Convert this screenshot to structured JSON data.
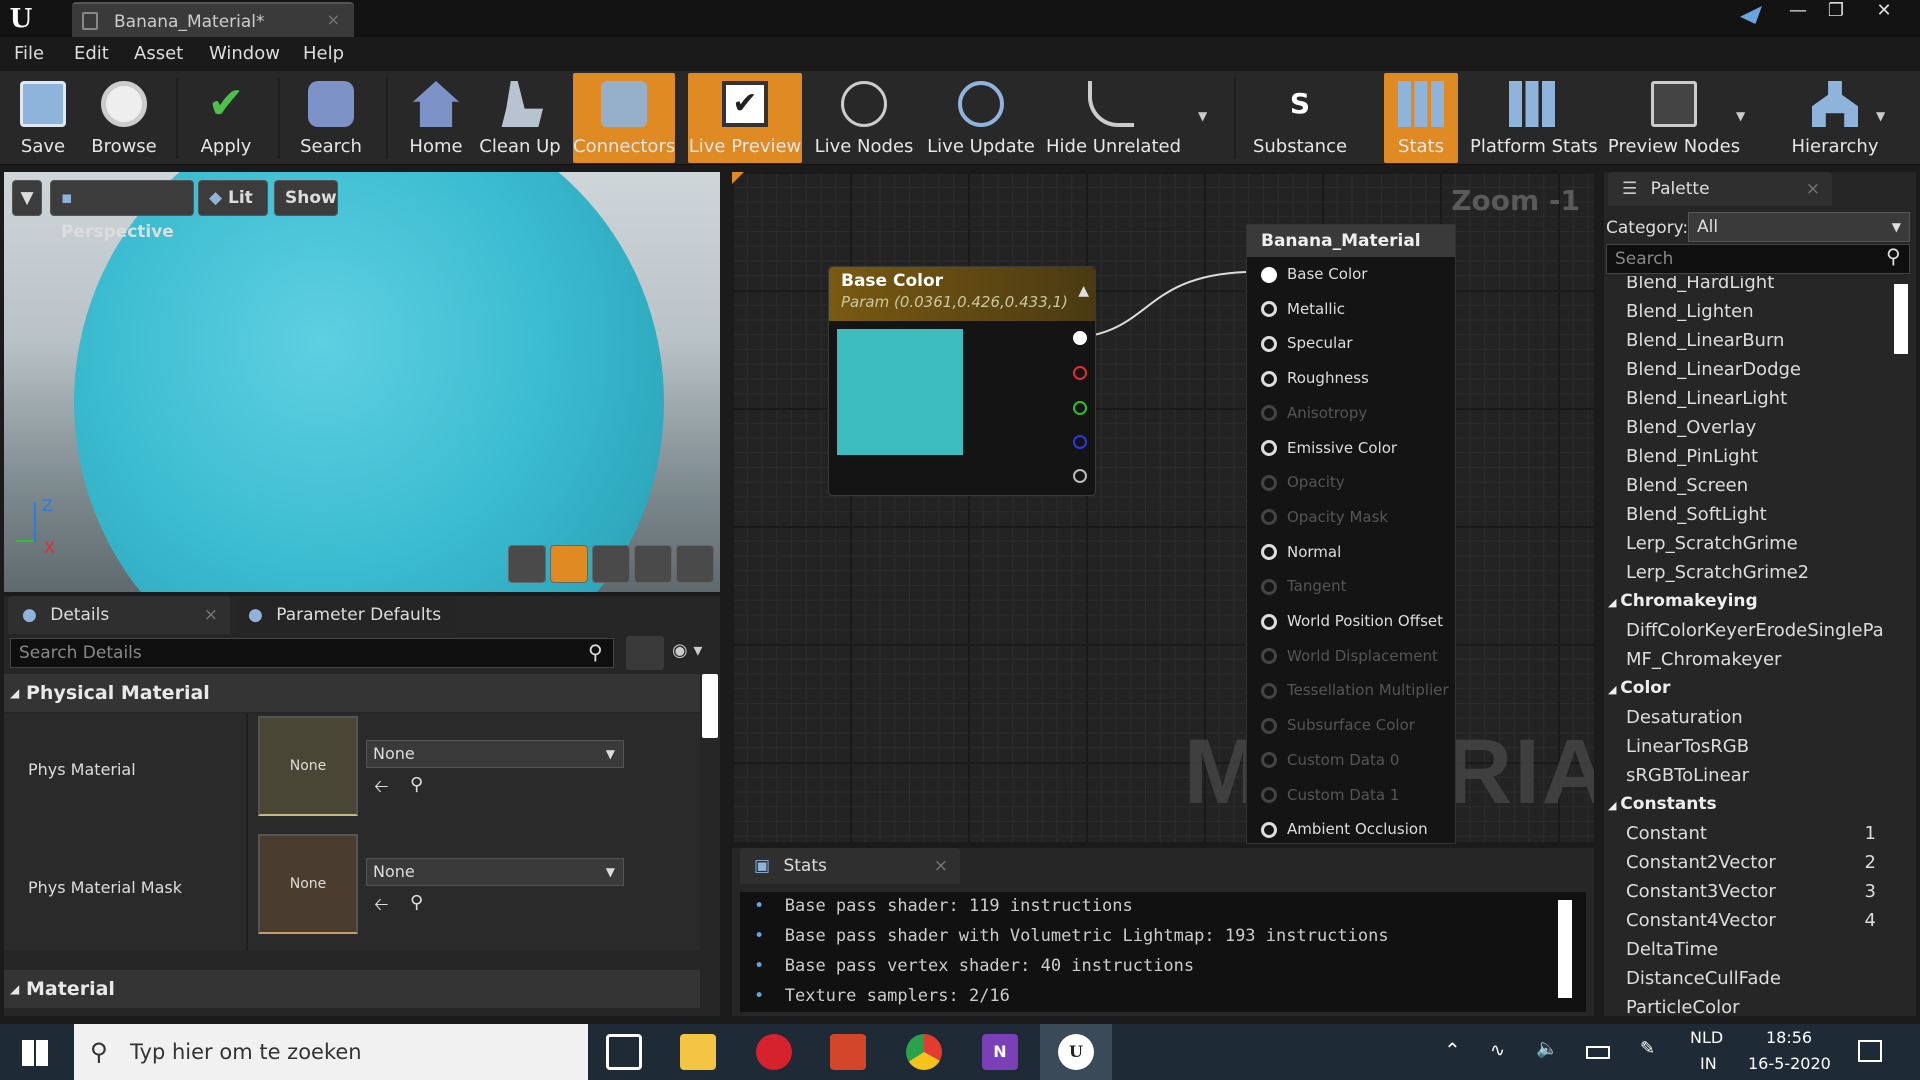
{
  "window": {
    "tab_title": "Banana_Material*",
    "close_symbol": "×"
  },
  "menu": [
    "File",
    "Edit",
    "Asset",
    "Window",
    "Help"
  ],
  "toolbar": {
    "buttons": [
      "Save",
      "Browse",
      "Apply",
      "Search",
      "Home",
      "Clean Up",
      "Connectors",
      "Live Preview",
      "Live Nodes",
      "Live Update",
      "Hide Unrelated",
      "Substance",
      "Stats",
      "Platform Stats",
      "Preview Nodes",
      "Hierarchy"
    ],
    "active": [
      "Connectors",
      "Live Preview",
      "Stats"
    ],
    "accent_color": "#e08a23"
  },
  "viewport": {
    "perspective": "Perspective",
    "lit": "Lit",
    "show": "Show",
    "axis_z": "Z",
    "axis_x": "X"
  },
  "details": {
    "tab_details": "Details",
    "tab_params": "Parameter Defaults",
    "search_placeholder": "Search Details",
    "cat_physical": "Physical Material",
    "phys_material_label": "Phys Material",
    "phys_material_thumb": "None",
    "phys_material_value": "None",
    "phys_mask_label": "Phys Material Mask",
    "phys_mask_thumb": "None",
    "phys_mask_value": "None",
    "cat_material": "Material"
  },
  "graph": {
    "zoom": "Zoom -1",
    "watermark": "MATERIAL",
    "param_node": {
      "title": "Base Color",
      "subtitle": "Param (0.0361,0.426,0.433,1)",
      "swatch_color": "#3cbcbc"
    },
    "material_node": {
      "title": "Banana_Material",
      "pins": [
        {
          "label": "Base Color",
          "enabled": true
        },
        {
          "label": "Metallic",
          "enabled": true
        },
        {
          "label": "Specular",
          "enabled": true
        },
        {
          "label": "Roughness",
          "enabled": true
        },
        {
          "label": "Anisotropy",
          "enabled": false
        },
        {
          "label": "Emissive Color",
          "enabled": true
        },
        {
          "label": "Opacity",
          "enabled": false
        },
        {
          "label": "Opacity Mask",
          "enabled": false
        },
        {
          "label": "Normal",
          "enabled": true
        },
        {
          "label": "Tangent",
          "enabled": false
        },
        {
          "label": "World Position Offset",
          "enabled": true
        },
        {
          "label": "World Displacement",
          "enabled": false
        },
        {
          "label": "Tessellation Multiplier",
          "enabled": false
        },
        {
          "label": "Subsurface Color",
          "enabled": false
        },
        {
          "label": "Custom Data 0",
          "enabled": false
        },
        {
          "label": "Custom Data 1",
          "enabled": false
        },
        {
          "label": "Ambient Occlusion",
          "enabled": true
        }
      ]
    }
  },
  "stats": {
    "tab": "Stats",
    "lines": [
      "Base pass shader: 119 instructions",
      "Base pass shader with Volumetric Lightmap: 193 instructions",
      "Base pass vertex shader: 40 instructions",
      "Texture samplers: 2/16"
    ]
  },
  "palette": {
    "tab": "Palette",
    "category_label": "Category:",
    "category_value": "All",
    "search_placeholder": "Search",
    "items": [
      {
        "label": "Blend_HardLight"
      },
      {
        "label": "Blend_Lighten"
      },
      {
        "label": "Blend_LinearBurn"
      },
      {
        "label": "Blend_LinearDodge"
      },
      {
        "label": "Blend_LinearLight"
      },
      {
        "label": "Blend_Overlay"
      },
      {
        "label": "Blend_PinLight"
      },
      {
        "label": "Blend_Screen"
      },
      {
        "label": "Blend_SoftLight"
      },
      {
        "label": "Lerp_ScratchGrime"
      },
      {
        "label": "Lerp_ScratchGrime2"
      },
      {
        "label": "Chromakeying",
        "header": true
      },
      {
        "label": "DiffColorKeyerErodeSinglePa"
      },
      {
        "label": "MF_Chromakeyer"
      },
      {
        "label": "Color",
        "header": true
      },
      {
        "label": "Desaturation"
      },
      {
        "label": "LinearTosRGB"
      },
      {
        "label": "sRGBToLinear"
      },
      {
        "label": "Constants",
        "header": true
      },
      {
        "label": "Constant",
        "key": "1"
      },
      {
        "label": "Constant2Vector",
        "key": "2"
      },
      {
        "label": "Constant3Vector",
        "key": "3"
      },
      {
        "label": "Constant4Vector",
        "key": "4"
      },
      {
        "label": "DeltaTime"
      },
      {
        "label": "DistanceCullFade"
      },
      {
        "label": "ParticleColor"
      }
    ]
  },
  "taskbar": {
    "search_placeholder": "Typ hier om te zoeken",
    "lang1": "NLD",
    "lang2": "IN",
    "time": "18:56",
    "date": "16-5-2020"
  }
}
